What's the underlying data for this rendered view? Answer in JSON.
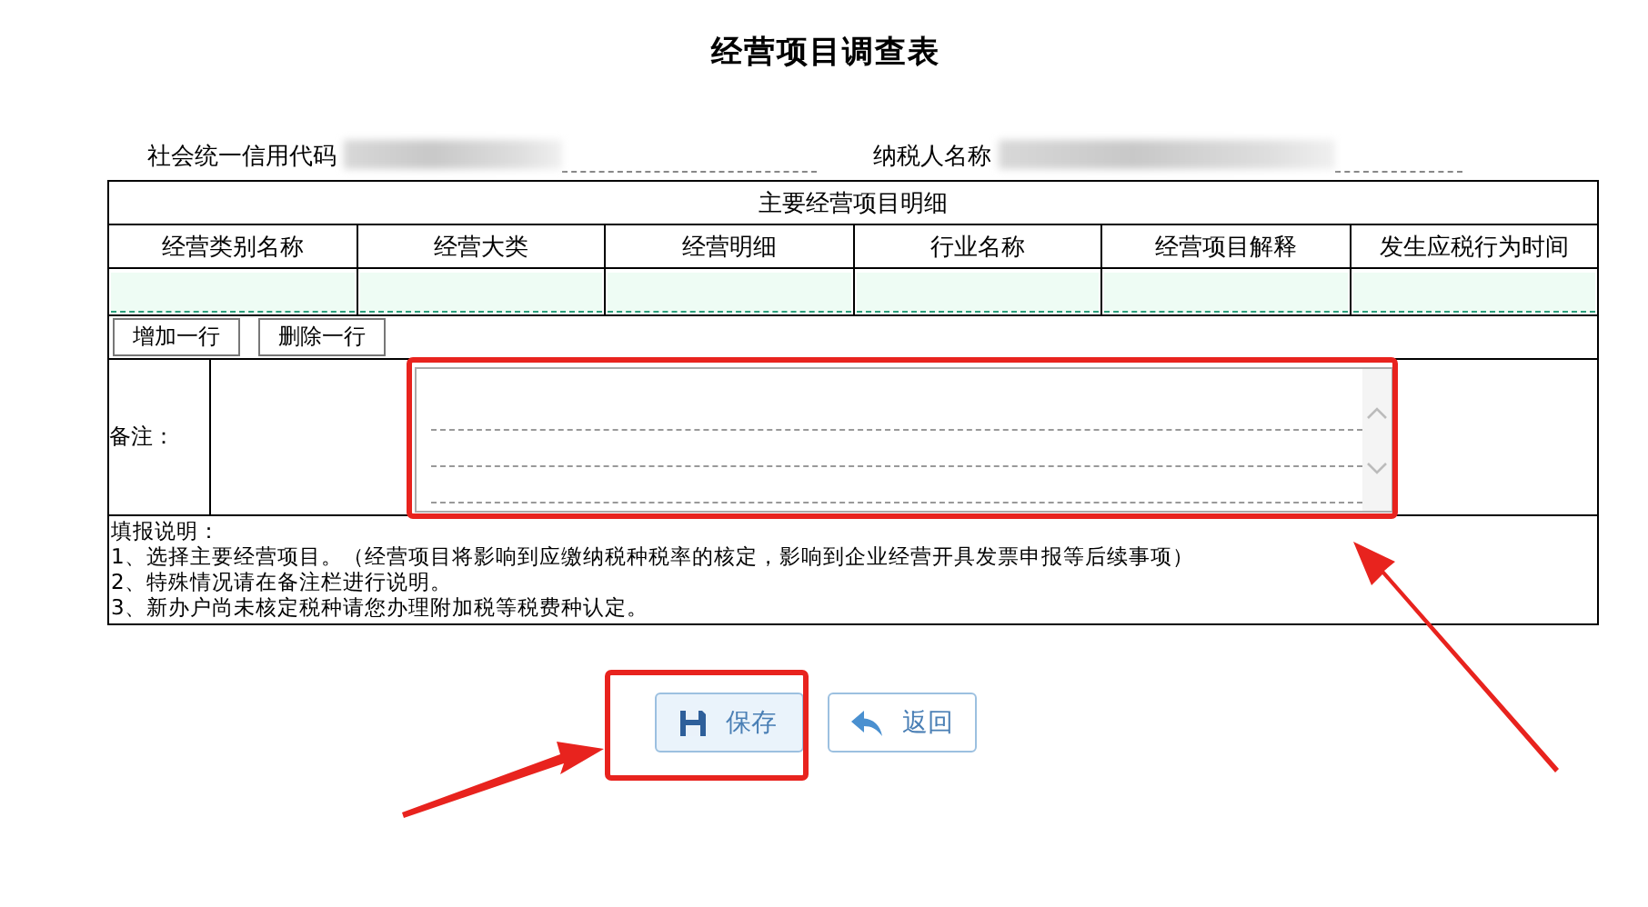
{
  "title": "经营项目调查表",
  "fields": [
    {
      "label": "社会统一信用代码"
    },
    {
      "label": "纳税人名称"
    }
  ],
  "table": {
    "caption": "主要经营项目明细",
    "columns": [
      "经营类别名称",
      "经营大类",
      "经营明细",
      "行业名称",
      "经营项目解释",
      "发生应税行为时间"
    ]
  },
  "row_buttons": [
    "增加一行",
    "删除一行"
  ],
  "remark": {
    "label": "备注："
  },
  "notes": [
    "填报说明：",
    "1、选择主要经营项目。（经营项目将影响到应缴纳税种税率的核定，影响到企业经营开具发票申报等后续事项）",
    "2、特殊情况请在备注栏进行说明。",
    "3、新办户尚未核定税种请您办理附加税等税费种认定。"
  ],
  "buttons": [
    {
      "label": "保存",
      "kind": "save"
    },
    {
      "label": "返回",
      "kind": "back"
    }
  ]
}
